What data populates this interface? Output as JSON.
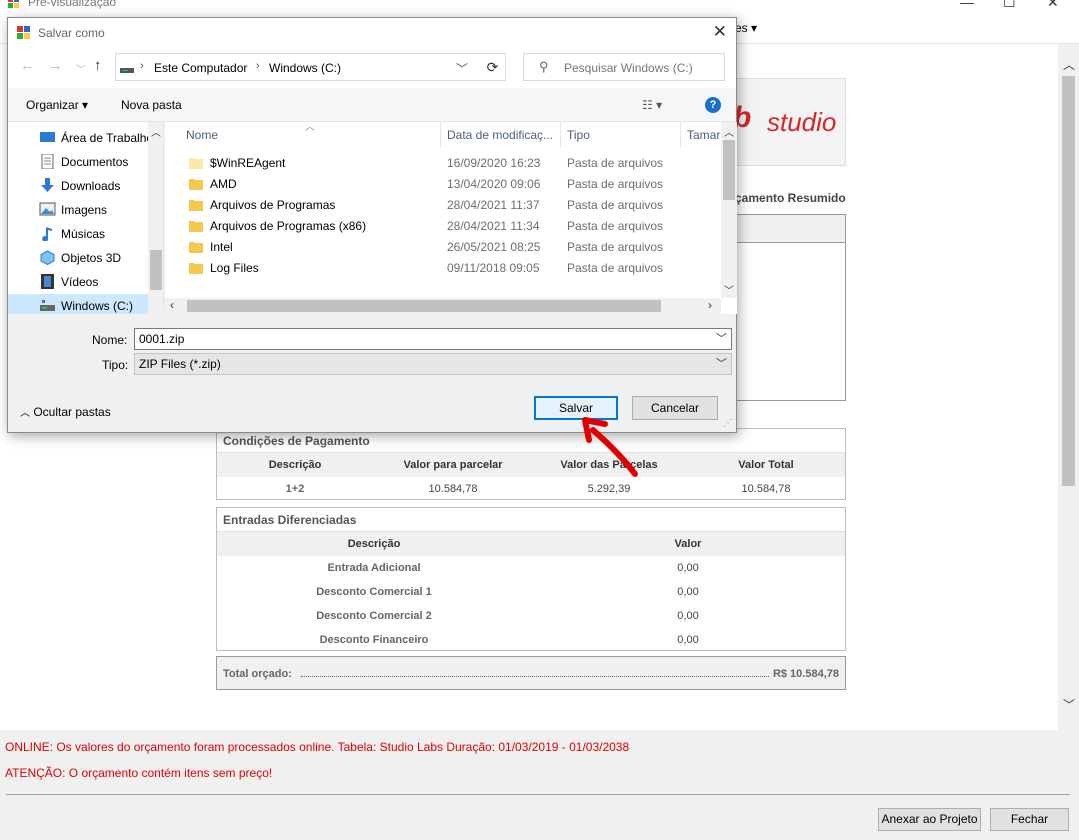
{
  "background": {
    "title": "Pré-visualização",
    "menu_partial": "es",
    "logo_letter": "b",
    "logo_text": "studio",
    "resumo_title": "çamento Resumido",
    "pagamento": {
      "title": "Condições de Pagamento",
      "headers": [
        "Descrição",
        "Valor para parcelar",
        "Valor das Parcelas",
        "Valor Total"
      ],
      "row": [
        "1+2",
        "10.584,78",
        "5.292,39",
        "10.584,78"
      ]
    },
    "entradas": {
      "title": "Entradas Diferenciadas",
      "headers": [
        "Descrição",
        "Valor"
      ],
      "rows": [
        [
          "Entrada Adicional",
          "0,00"
        ],
        [
          "Desconto Comercial 1",
          "0,00"
        ],
        [
          "Desconto Comercial 2",
          "0,00"
        ],
        [
          "Desconto Financeiro",
          "0,00"
        ]
      ]
    },
    "total_label": "Total orçado:",
    "total_value": "R$ 10.584,78",
    "msg_online": "ONLINE: Os valores do orçamento foram processados online. Tabela:  Studio Labs Duração: 01/03/2019 - 01/03/2038",
    "msg_atencao": "ATENÇÃO: O orçamento contém itens sem preço!",
    "btn_anexar": "Anexar ao Projeto",
    "btn_fechar": "Fechar"
  },
  "dialog": {
    "title": "Salvar como",
    "address": [
      "Este Computador",
      "Windows (C:)"
    ],
    "search_placeholder": "Pesquisar Windows (C:)",
    "toolbar": {
      "organize": "Organizar",
      "new_folder": "Nova pasta"
    },
    "nav_items": [
      {
        "label": "Área de Trabalho",
        "icon": "desktop-icon"
      },
      {
        "label": "Documentos",
        "icon": "documents-icon"
      },
      {
        "label": "Downloads",
        "icon": "downloads-icon"
      },
      {
        "label": "Imagens",
        "icon": "pictures-icon"
      },
      {
        "label": "Músicas",
        "icon": "music-icon"
      },
      {
        "label": "Objetos 3D",
        "icon": "objects3d-icon"
      },
      {
        "label": "Vídeos",
        "icon": "videos-icon"
      },
      {
        "label": "Windows (C:)",
        "icon": "drive-icon"
      }
    ],
    "columns": [
      "Nome",
      "Data de modificaç...",
      "Tipo",
      "Tamar"
    ],
    "files": [
      {
        "name": "$WinREAgent",
        "date": "16/09/2020 16:23",
        "type": "Pasta de arquivos"
      },
      {
        "name": "AMD",
        "date": "13/04/2020 09:06",
        "type": "Pasta de arquivos"
      },
      {
        "name": "Arquivos de Programas",
        "date": "28/04/2021 11:37",
        "type": "Pasta de arquivos"
      },
      {
        "name": "Arquivos de Programas (x86)",
        "date": "28/04/2021 11:34",
        "type": "Pasta de arquivos"
      },
      {
        "name": "Intel",
        "date": "26/05/2021 08:25",
        "type": "Pasta de arquivos"
      },
      {
        "name": "Log Files",
        "date": "09/11/2018 09:05",
        "type": "Pasta de arquivos"
      }
    ],
    "name_label": "Nome:",
    "name_value": "0001.zip",
    "type_label": "Tipo:",
    "type_value": "ZIP Files (*.zip)",
    "hide_folders": "Ocultar pastas",
    "save": "Salvar",
    "cancel": "Cancelar"
  },
  "colors": {
    "accent": "#0078d7",
    "selection": "#cce8ff",
    "alert": "#e00000",
    "brand": "#d7252c"
  }
}
